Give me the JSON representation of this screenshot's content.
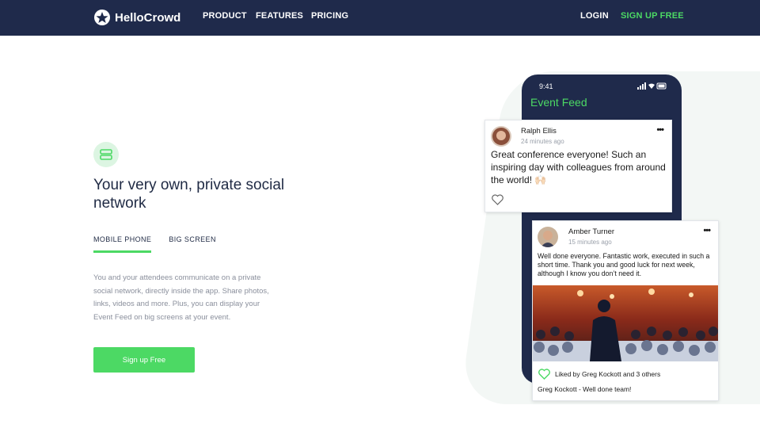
{
  "nav": {
    "brand": "HelloCrowd",
    "links": [
      "PRODUCT",
      "FEATURES",
      "PRICING"
    ],
    "login": "LOGIN",
    "signup": "SIGN UP FREE"
  },
  "hero": {
    "headline": "Your very own, private social network",
    "tabs": [
      "MOBILE PHONE",
      "BIG SCREEN"
    ],
    "active_tab": "MOBILE PHONE",
    "description": "You and your attendees communicate on a private social network, directly inside the app. Share photos, links, videos and more. Plus, you can display your Event Feed on big screens at your event.",
    "cta": "Sign up Free"
  },
  "phone": {
    "time": "9:41",
    "feed_title": "Event Feed"
  },
  "posts": [
    {
      "author": "Ralph Ellis",
      "time": "24 minutes ago",
      "text": "Great conference everyone! Such an inspiring day with colleagues from around the world! 🙌🏻"
    },
    {
      "author": "Amber Turner",
      "time": "15 minutes ago",
      "text": "Well done everyone. Fantastic work, executed in such a short time. Thank you and good luck for next week, although I know you don’t need it.",
      "likes": "Liked by Greg Kockott and 3 others",
      "comment": "Greg Kockott - Well done team!"
    }
  ],
  "colors": {
    "navy": "#1f2a4b",
    "green": "#4cd964"
  }
}
